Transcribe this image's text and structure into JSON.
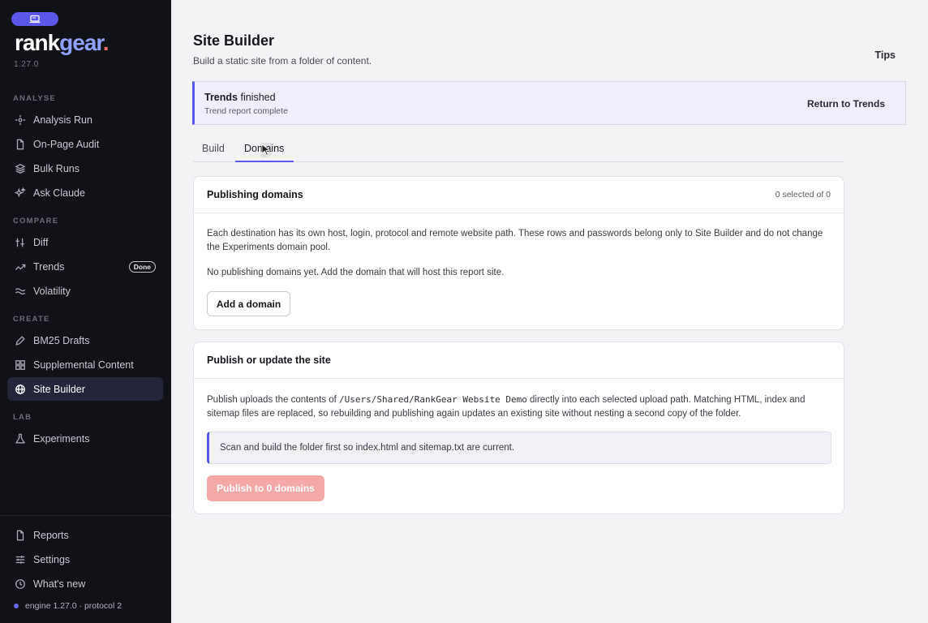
{
  "app": {
    "brand_part1": "rank",
    "brand_part2": "gear",
    "brand_dot": ".",
    "version": "1.27.0"
  },
  "sidebar": {
    "sections": {
      "analyse": "ANALYSE",
      "compare": "COMPARE",
      "create": "CREATE",
      "lab": "LAB"
    },
    "items": [
      {
        "label": "Analysis Run",
        "icon": "sparkle-icon"
      },
      {
        "label": "On-Page Audit",
        "icon": "document-icon"
      },
      {
        "label": "Bulk Runs",
        "icon": "layers-icon"
      },
      {
        "label": "Ask Claude",
        "icon": "stars-icon"
      },
      {
        "label": "Diff",
        "icon": "sliders-icon"
      },
      {
        "label": "Trends",
        "icon": "trend-icon",
        "badge": "Done"
      },
      {
        "label": "Volatility",
        "icon": "wave-icon"
      },
      {
        "label": "BM25 Drafts",
        "icon": "pencil-icon"
      },
      {
        "label": "Supplemental Content",
        "icon": "grid-icon"
      },
      {
        "label": "Site Builder",
        "icon": "globe-icon"
      },
      {
        "label": "Experiments",
        "icon": "flask-icon"
      }
    ],
    "footer_items": [
      {
        "label": "Reports",
        "icon": "document-icon"
      },
      {
        "label": "Settings",
        "icon": "settings-icon"
      },
      {
        "label": "What's new",
        "icon": "clock-icon"
      }
    ],
    "engine": "engine 1.27.0 · protocol 2"
  },
  "header": {
    "title": "Site Builder",
    "subtitle": "Build a static site from a folder of content.",
    "tips": "Tips"
  },
  "notice": {
    "bold": "Trends",
    "rest": " finished",
    "detail": "Trend report complete",
    "action": "Return to Trends"
  },
  "tabs": [
    {
      "label": "Build"
    },
    {
      "label": "Domains"
    }
  ],
  "publishing_domains": {
    "title": "Publishing domains",
    "count": "0 selected of 0",
    "description": "Each destination has its own host, login, protocol and remote website path. These rows and passwords belong only to Site Builder and do not change the Experiments domain pool.",
    "empty": "No publishing domains yet. Add the domain that will host this report site.",
    "add_button": "Add a domain"
  },
  "publish": {
    "title": "Publish or update the site",
    "desc_before": "Publish uploads the contents of ",
    "path": "/Users/Shared/RankGear Website Demo",
    "desc_after": " directly into each selected upload path. Matching HTML, index and sitemap files are replaced, so rebuilding and publishing again updates an existing site without nesting a second copy of the folder.",
    "callout": "Scan and build the folder first so index.html and sitemap.txt are current.",
    "button": "Publish to 0 domains"
  },
  "colors": {
    "accent": "#5b57e8",
    "sidebar_bg": "#111118",
    "publish_disabled": "#f4a9a7"
  }
}
